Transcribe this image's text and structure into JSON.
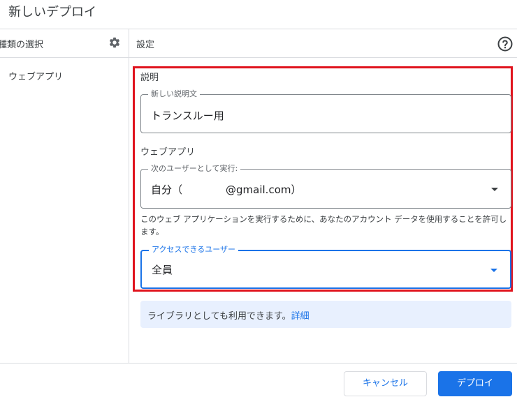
{
  "dialog": {
    "title": "新しいデプロイ"
  },
  "left_panel": {
    "header_label": "種類の選択",
    "header_icon": "gear-icon",
    "items": [
      {
        "label": "ウェブアプリ"
      }
    ]
  },
  "right_panel": {
    "header_label": "設定",
    "header_icon": "help-icon",
    "description_section": {
      "title": "説明",
      "field_label": "新しい説明文",
      "field_value": "トランスルー用"
    },
    "webapp_section": {
      "title": "ウェブアプリ",
      "execute_as_label": "次のユーザーとして実行:",
      "execute_as_value_prefix": "自分（",
      "execute_as_value_suffix": "@gmail.com）",
      "execute_as_hint": "このウェブ アプリケーションを実行するために、あなたのアカウント データを使用することを許可します。",
      "access_label": "アクセスできるユーザー",
      "access_value": "全員"
    },
    "library_info": {
      "text": "ライブラリとしても利用できます。",
      "link": "詳細"
    }
  },
  "footer": {
    "cancel_label": "キャンセル",
    "deploy_label": "デプロイ"
  },
  "colors": {
    "accent": "#1a73e8",
    "highlight_border": "#e0131d",
    "info_bg": "#e8f0fe"
  }
}
